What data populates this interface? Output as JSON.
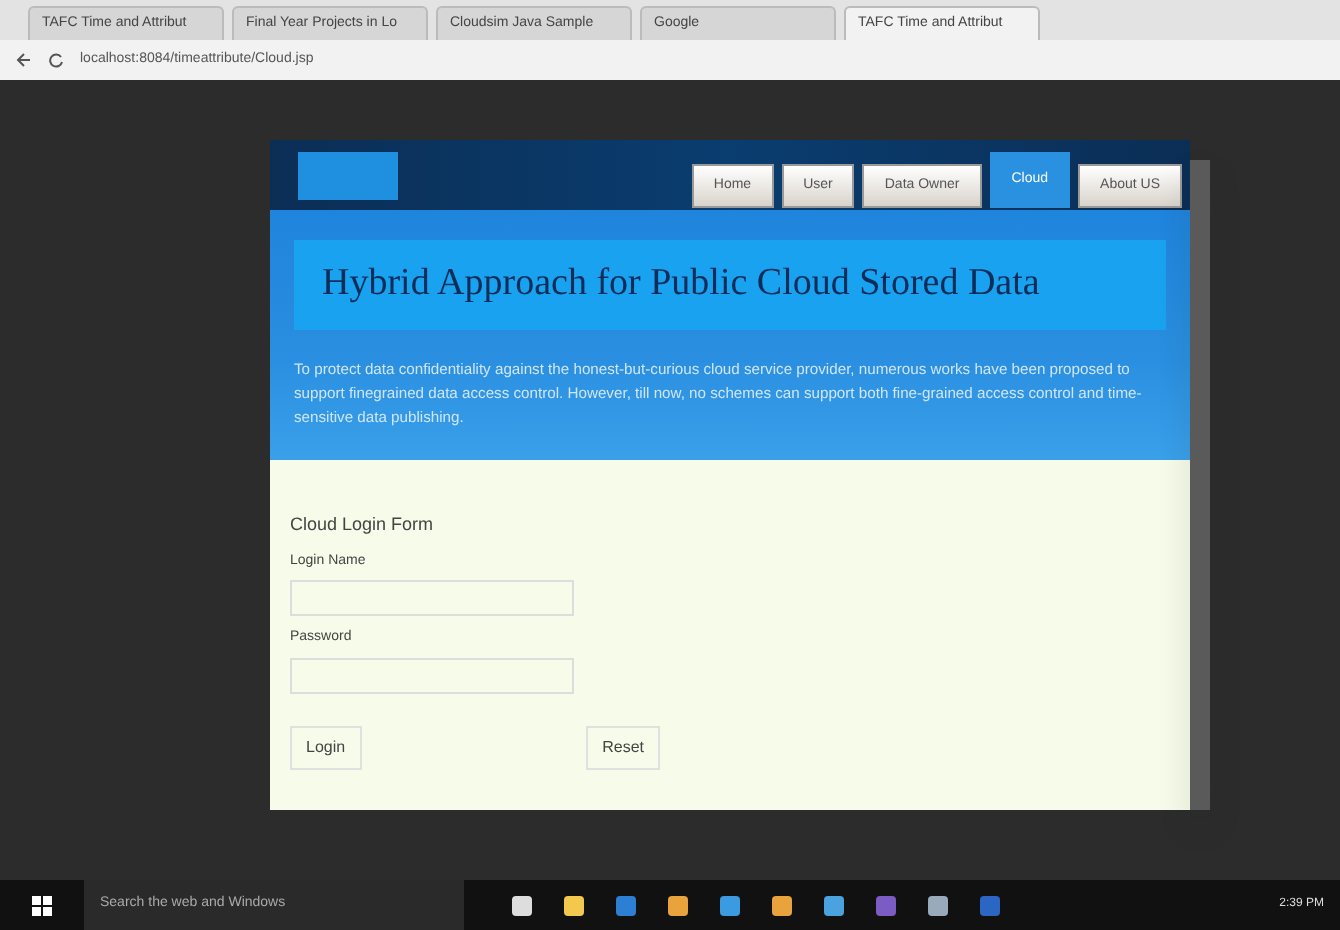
{
  "browser": {
    "tabs": [
      {
        "title": "TAFC Time and Attribut",
        "selected": false
      },
      {
        "title": "Final Year Projects in Lo",
        "selected": false
      },
      {
        "title": "Cloudsim Java Sample",
        "selected": false
      },
      {
        "title": "Google",
        "selected": false
      },
      {
        "title": "TAFC Time and Attribut",
        "selected": true
      }
    ],
    "url": "localhost:8084/timeattribute/Cloud.jsp"
  },
  "nav": [
    {
      "label": "Home",
      "selected": false
    },
    {
      "label": "User",
      "selected": false
    },
    {
      "label": "Data Owner",
      "selected": false
    },
    {
      "label": "Cloud",
      "selected": true
    },
    {
      "label": "About US",
      "selected": false
    }
  ],
  "title": "Hybrid Approach for Public Cloud Stored Data",
  "intro": "To protect data confidentiality against the honest-but-curious cloud service provider, numerous works have been proposed to support finegrained data access control. However, till now, no schemes can support both fine-grained access control and time-sensitive data publishing.",
  "form": {
    "heading": "Cloud Login Form",
    "fields": [
      {
        "label": "Login Name"
      },
      {
        "label": "Password"
      }
    ],
    "buttons": [
      "Login",
      "Reset"
    ]
  },
  "taskbar": {
    "search": "Search the web and Windows",
    "time": "2:39 PM"
  }
}
